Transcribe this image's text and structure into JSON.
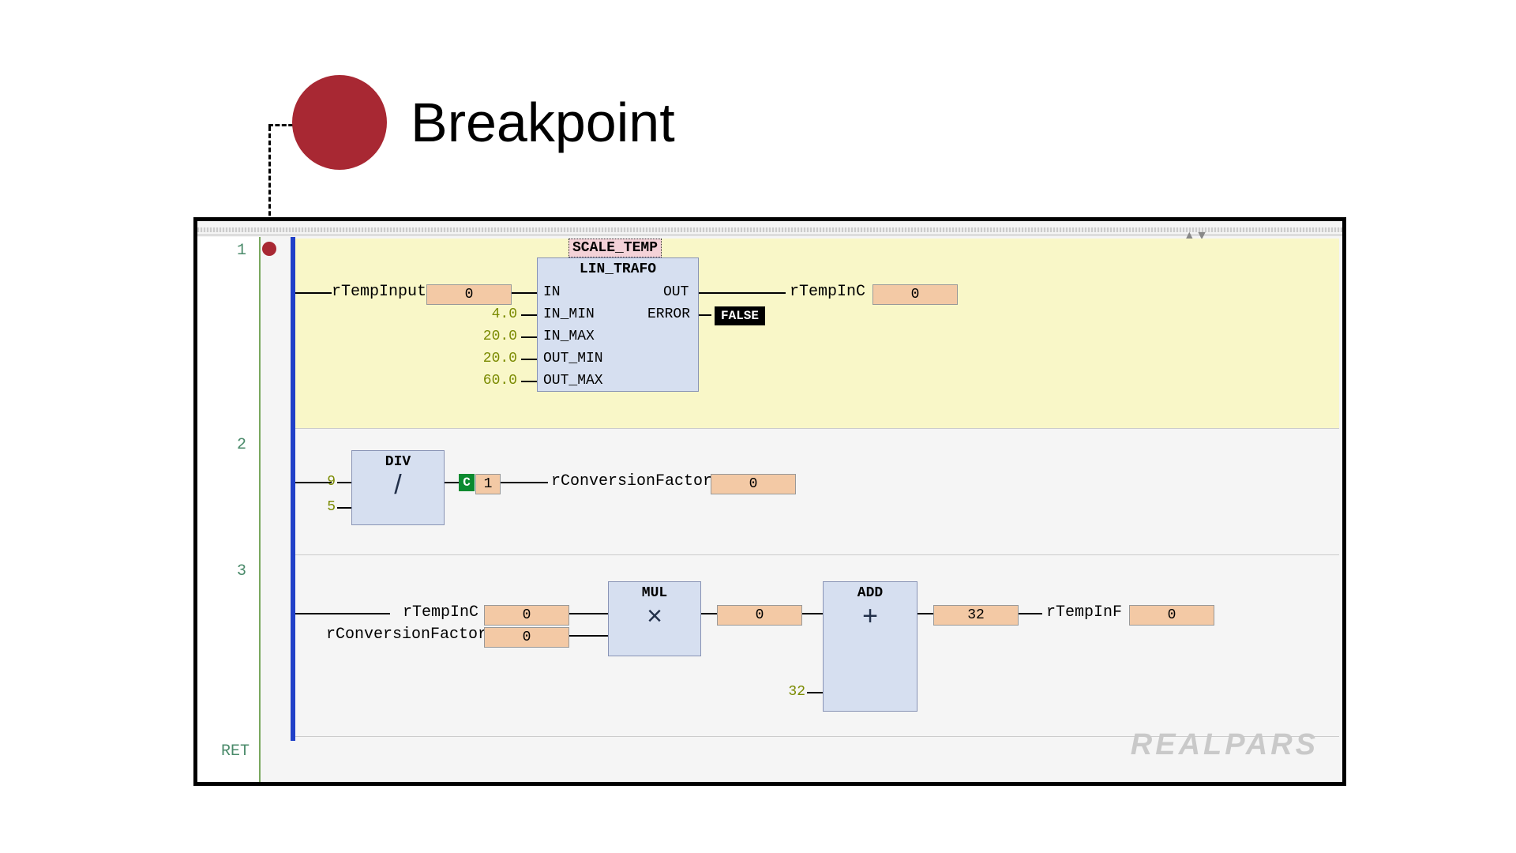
{
  "title": "Breakpoint",
  "logo": "REALPARS",
  "gutter": {
    "n1": "1",
    "n2": "2",
    "n3": "3",
    "ret": "RET"
  },
  "net1": {
    "instance": "SCALE_TEMP",
    "block": "LIN_TRAFO",
    "ports": {
      "in": "IN",
      "in_min": "IN_MIN",
      "in_max": "IN_MAX",
      "out_min": "OUT_MIN",
      "out_max": "OUT_MAX",
      "out": "OUT",
      "error": "ERROR"
    },
    "consts": {
      "in_min": "4.0",
      "in_max": "20.0",
      "out_min": "20.0",
      "out_max": "60.0"
    },
    "in_var": "rTempInput",
    "in_val": "0",
    "out_var": "rTempInC",
    "out_val": "0",
    "error_val": "FALSE"
  },
  "net2": {
    "block": "DIV",
    "op": "/",
    "in1": "9",
    "in2": "5",
    "c": "C",
    "cval": "1",
    "out_var": "rConversionFactor",
    "out_val": "0"
  },
  "net3": {
    "mul": {
      "title": "MUL",
      "op": "×"
    },
    "add": {
      "title": "ADD",
      "op": "+"
    },
    "in1_var": "rTempInC",
    "in1_val": "0",
    "in2_var": "rConversionFactor",
    "in2_val": "0",
    "mul_out_val": "0",
    "add_in2_const": "32",
    "add_mid_val": "32",
    "out_var": "rTempInF",
    "out_val": "0"
  }
}
